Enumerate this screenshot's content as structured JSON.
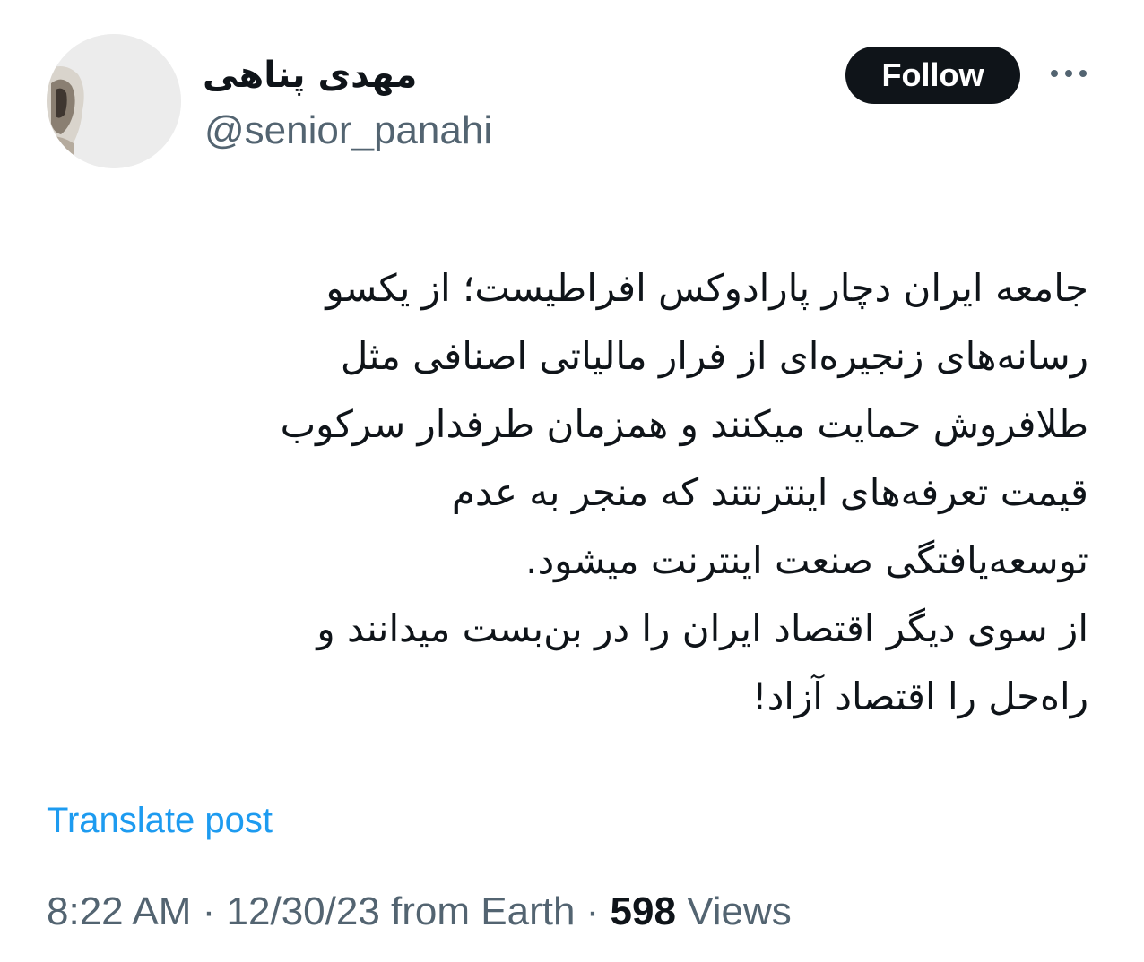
{
  "author": {
    "display_name": "مهدی پناهی",
    "handle": "@senior_panahi"
  },
  "actions": {
    "follow_label": "Follow",
    "more_icon": "more-horizontal-icon"
  },
  "tweet": {
    "lines": [
      "جامعه ایران دچار پارادوکس افراطیست؛ از یکسو",
      "رسانه‌های زنجیره‌ای از فرار مالیاتی اصنافی مثل",
      "طلافروش حمایت میکنند و همزمان طرفدار سرکوب",
      "قیمت تعرفه‌های اینترنتند که منجر به عدم",
      "توسعه‌یافتگی صنعت اینترنت میشود.",
      "از سوی دیگر اقتصاد ایران را در بن‌بست میدانند و",
      "راه‌حل را اقتصاد آزاد!"
    ]
  },
  "translate_label": "Translate post",
  "meta": {
    "time": "8:22 AM",
    "separator": " · ",
    "date": "12/30/23 from Earth",
    "views_count": "598",
    "views_label": "Views"
  },
  "colors": {
    "text_primary": "#0f1419",
    "text_secondary": "#536471",
    "link": "#1d9bf0",
    "button_bg": "#0f1419"
  }
}
